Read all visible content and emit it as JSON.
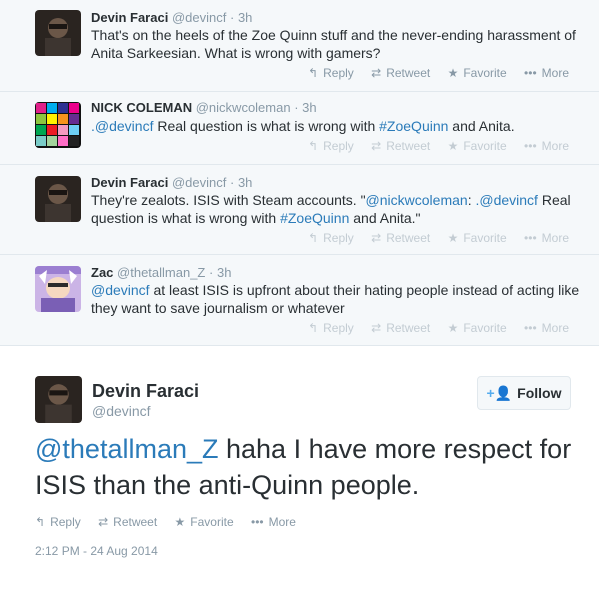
{
  "thread": [
    {
      "name": "Devin Faraci",
      "handle": "@devincf",
      "time": "3h",
      "text_parts": [
        "That's on the heels of the Zoe Quinn stuff and the never-ending harassment of Anita Sarkeesian. What is wrong with gamers?"
      ],
      "actions": [
        "Reply",
        "Retweet",
        "Favorite",
        "More"
      ]
    },
    {
      "name": "NICK COLEMAN",
      "handle": "@nickwcoleman",
      "time": "3h",
      "mention": ".@devincf",
      "text_a": " Real question is what is wrong with ",
      "hashtag": "#ZoeQuinn",
      "text_b": " and Anita.",
      "actions": [
        "Reply",
        "Retweet",
        "Favorite",
        "More"
      ]
    },
    {
      "name": "Devin Faraci",
      "handle": "@devincf",
      "time": "3h",
      "text_a": "They're zealots. ISIS with Steam accounts. \"",
      "mention_a": "@nickwcoleman",
      "text_b": ": ",
      "mention_b": ".@devincf",
      "text_c": " Real question is what is wrong with ",
      "hashtag": "#ZoeQuinn",
      "text_d": " and Anita.\"",
      "actions": [
        "Reply",
        "Retweet",
        "Favorite",
        "More"
      ]
    },
    {
      "name": "Zac",
      "handle": "@thetallman_Z",
      "time": "3h",
      "mention": "@devincf",
      "text_a": " at least ISIS is upfront about their hating people instead of acting like they want to save journalism or whatever",
      "actions": [
        "Reply",
        "Retweet",
        "Favorite",
        "More"
      ]
    }
  ],
  "main": {
    "name": "Devin Faraci",
    "handle": "@devincf",
    "follow_label": "Follow",
    "mention": "@thetallman_Z",
    "text": " haha I have more respect for ISIS than the anti-Quinn people.",
    "actions": [
      "Reply",
      "Retweet",
      "Favorite",
      "More"
    ],
    "timestamp": "2:12 PM - 24 Aug 2014"
  },
  "icons": {
    "reply": "reply-icon",
    "retweet": "retweet-icon",
    "favorite": "star-icon",
    "more": "more-dots-icon",
    "follow": "add-user-icon"
  },
  "colors": {
    "link": "#2b7bb9",
    "muted": "#8899a6",
    "accent": "#55acee",
    "thread_bg": "#f5f8fa"
  }
}
